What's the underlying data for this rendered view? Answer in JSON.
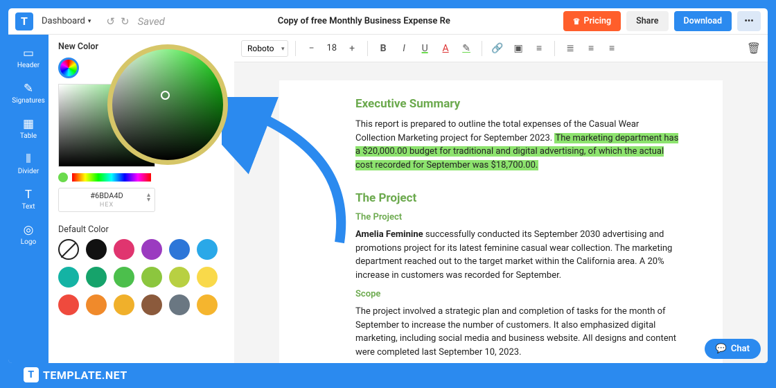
{
  "topbar": {
    "dashboard": "Dashboard",
    "saved": "Saved",
    "title": "Copy of free Monthly Business Expense Re",
    "pricing": "Pricing",
    "share": "Share",
    "download": "Download",
    "more": "•••"
  },
  "sidebar": {
    "items": [
      {
        "icon": "▭",
        "label": "Header"
      },
      {
        "icon": "✎",
        "label": "Signatures"
      },
      {
        "icon": "▦",
        "label": "Table"
      },
      {
        "icon": "⦀",
        "label": "Divider"
      },
      {
        "icon": "T",
        "label": "Text"
      },
      {
        "icon": "◎",
        "label": "Logo"
      }
    ]
  },
  "colorpanel": {
    "new_color": "New Color",
    "hex_value": "#6BDA4D",
    "hex_label": "HEX",
    "default_color": "Default Color",
    "hue_current": "#6BDA4D"
  },
  "swatches": [
    "none",
    "#111111",
    "#e0356f",
    "#9b3bc0",
    "#2d76d8",
    "#2aa8e8",
    "#14b3a4",
    "#16a36b",
    "#4cbf4c",
    "#8cc63e",
    "#b8d042",
    "#f9d94a",
    "#ef4a3d",
    "#f08a2b",
    "#f0b02b",
    "#8b5a3c",
    "#6a7782",
    "#f5b52e"
  ],
  "toolbar": {
    "font": "Roboto",
    "font_size": "18",
    "bold": "B",
    "italic": "I",
    "underline": "U",
    "textcolor": "A",
    "highlight": "✎",
    "link": "🔗",
    "image": "▣",
    "align": "≡",
    "list1": "≣",
    "list2": "≡",
    "list3": "≡"
  },
  "document": {
    "h1": "Executive Summary",
    "p1a": "This report is prepared to outline the total expenses of the Casual Wear Collection Marketing project for September 2023. ",
    "p1b": "The marketing department has a $20,000.00 budget for traditional and digital advertising, of which the actual cost recorded for September was $18,700.00.",
    "h2": "The Project",
    "sub1": "The Project",
    "bold_name": "Amelia Feminine",
    "p2": " successfully conducted its September 2030 advertising and promotions project for its latest feminine casual wear collection. The marketing department reached out to the target market within the California area. A 20% increase in customers was recorded for September.",
    "sub2": "Scope",
    "p3": "The project involved a strategic plan and completion of tasks for the month of September to increase the number of customers. It also emphasized digital marketing, including social media and business website. All designs and content were completed last September 10, 2023."
  },
  "chat": "Chat",
  "branding": "TEMPLATE.NET"
}
